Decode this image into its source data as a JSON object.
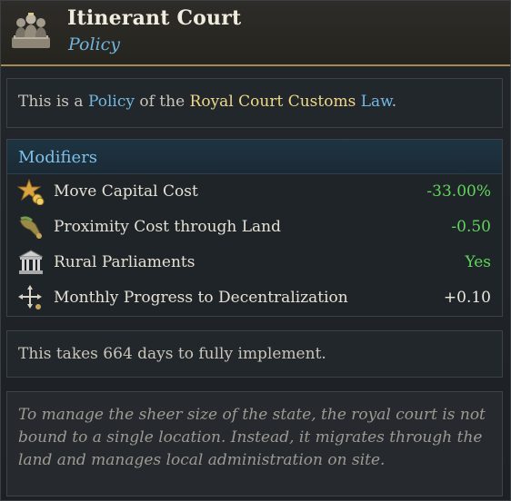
{
  "header": {
    "title": "Itinerant Court",
    "subtitle": "Policy",
    "icon": "royal-court-icon"
  },
  "intro": {
    "prefix": "This is a ",
    "policy_word": "Policy",
    "middle": " of the ",
    "law_name": "Royal Court Customs",
    "space": " ",
    "law_word": "Law",
    "suffix": "."
  },
  "modifiers": {
    "heading": "Modifiers",
    "items": [
      {
        "icon": "star-gold-icon",
        "label": "Move Capital Cost",
        "value": "-33.00%",
        "color": "#5fd65a"
      },
      {
        "icon": "horn-icon",
        "label": "Proximity Cost through Land",
        "value": "-0.50",
        "color": "#5fd65a"
      },
      {
        "icon": "parliament-icon",
        "label": "Rural Parliaments",
        "value": "Yes",
        "color": "#5fd65a"
      },
      {
        "icon": "decentralization-arrows-icon",
        "label": "Monthly Progress to Decentralization",
        "value": "+0.10",
        "color": "#ece8de"
      }
    ]
  },
  "implementation": {
    "text": "This takes 664 days to fully implement."
  },
  "flavor": {
    "text": "To manage the sheer size of the state, the royal court is not bound to a single location. Instead, it migrates through the land and manages local administration on site."
  },
  "colors": {
    "accent_blue": "#73b8e3",
    "accent_gold": "#f0d98a",
    "positive_green": "#5fd65a",
    "header_border": "#a58a52"
  }
}
